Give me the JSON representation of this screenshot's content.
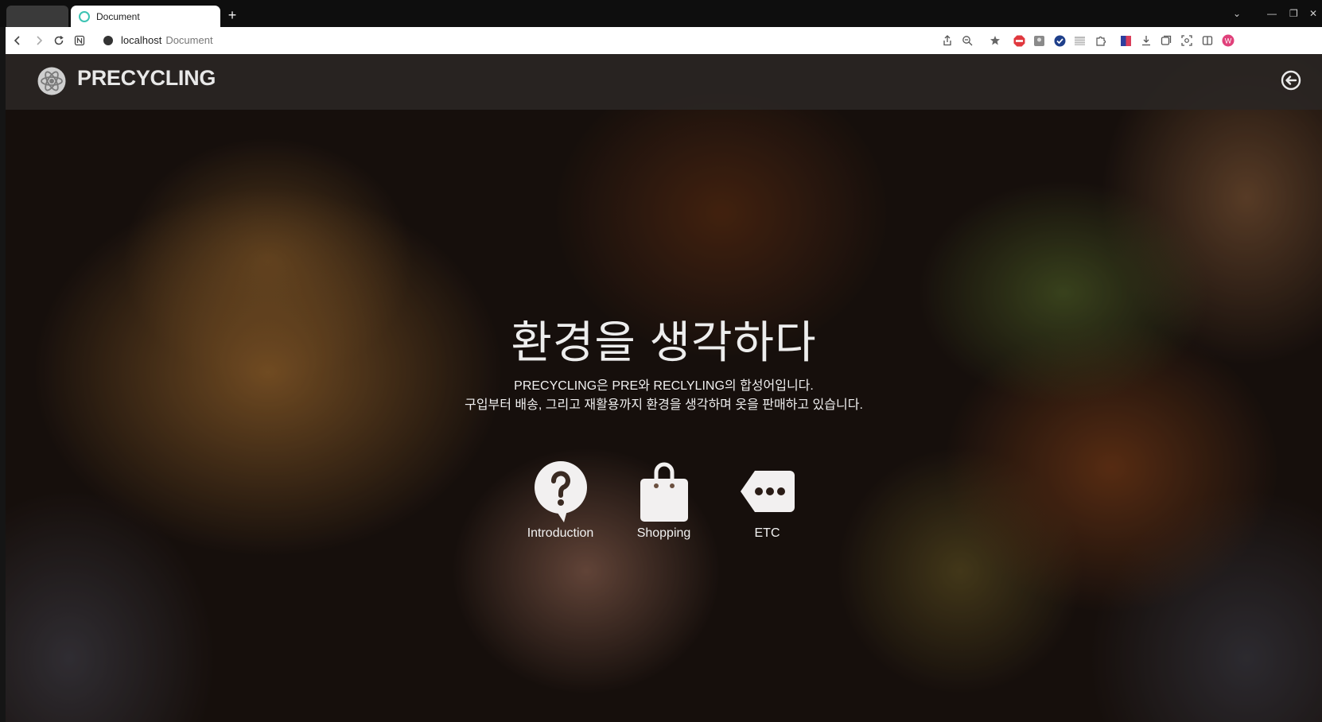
{
  "browser": {
    "tab_title": "Document",
    "new_tab_label": "+",
    "url_host": "localhost",
    "url_title": "Document",
    "window_controls": {
      "dropdown": "⌄",
      "minimize": "—",
      "restore": "❐",
      "close": "✕"
    },
    "profile_initial": "W",
    "colors": {
      "tab_favicon": "#3cc3b3",
      "adblock": "#e0383e",
      "profile": "#e0407a"
    }
  },
  "site": {
    "logo_text": "PRECYCLING",
    "hero": {
      "title": "환경을 생각하다",
      "line1": "PRECYCLING은 PRE와 RECLYLING의 합성어입니다.",
      "line2": "구입부터 배송, 그리고 재활용까지 환경을 생각하며 옷을 판매하고 있습니다."
    },
    "menu": [
      {
        "label": "Introduction",
        "icon": "question-bubble-icon"
      },
      {
        "label": "Shopping",
        "icon": "shopping-bag-icon"
      },
      {
        "label": "ETC",
        "icon": "more-tag-icon"
      }
    ],
    "logout_icon": "logout-arrow-icon"
  }
}
